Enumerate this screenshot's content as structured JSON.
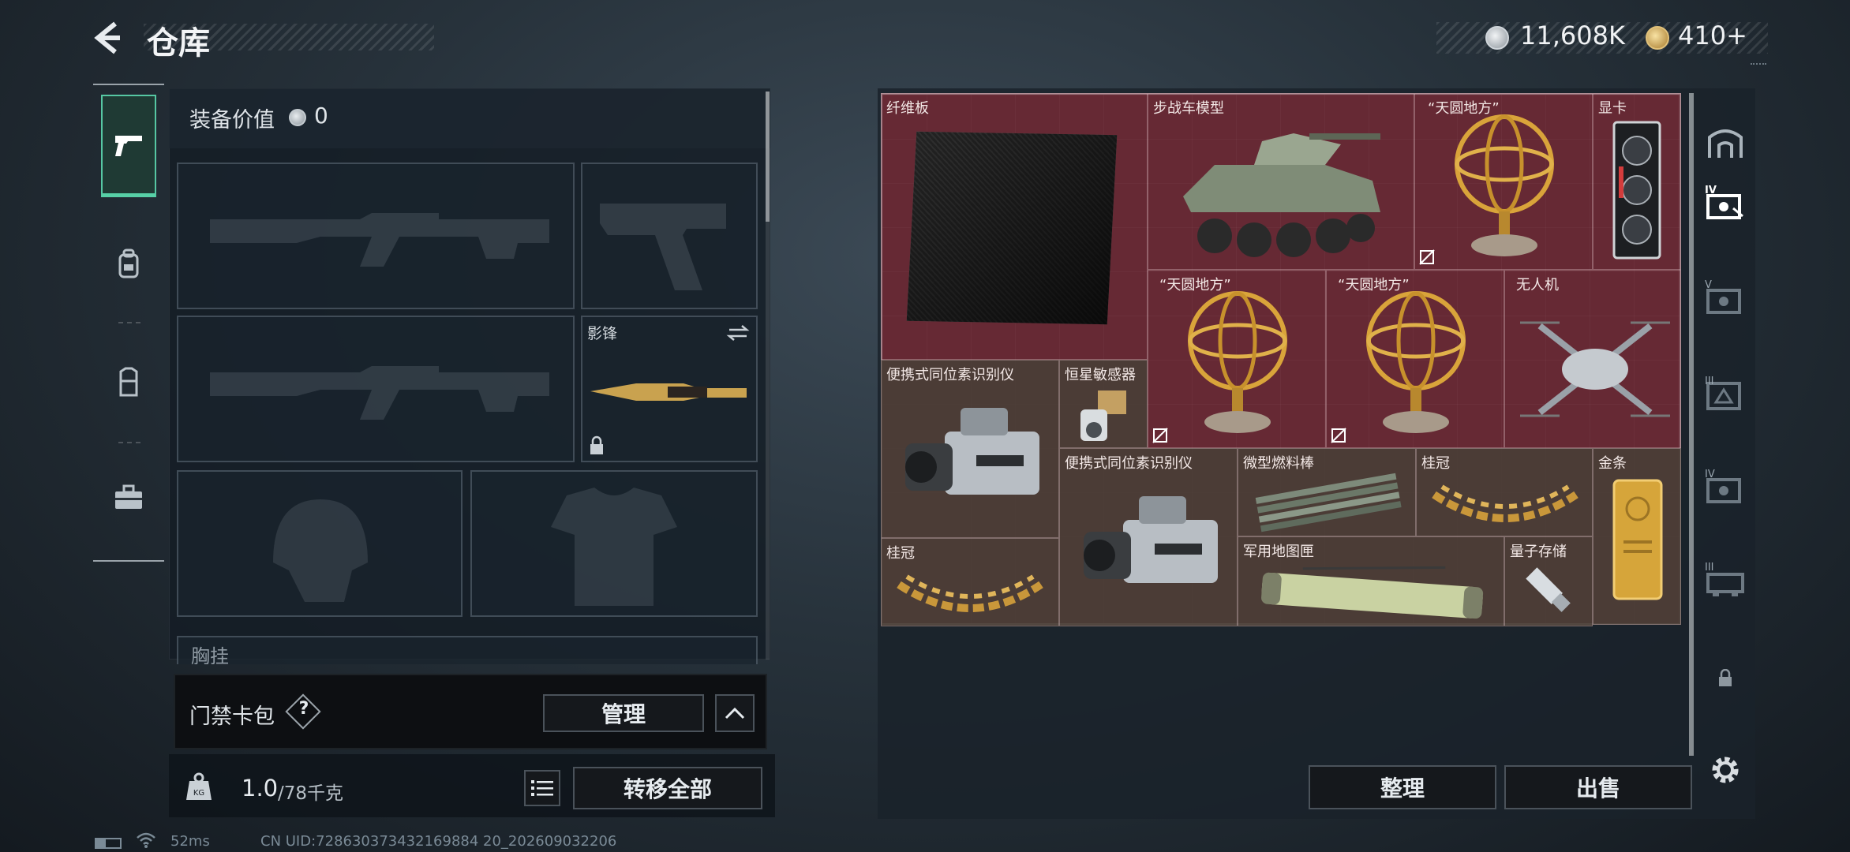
{
  "header": {
    "title": "仓库",
    "currencies": [
      {
        "icon": "silver-coin-icon",
        "value": "11,608K"
      },
      {
        "icon": "gold-coin-icon",
        "value": "410+"
      }
    ]
  },
  "tabs": [
    {
      "name": "pistol-icon",
      "active": true
    },
    {
      "name": "backpack-icon",
      "active": false
    },
    {
      "name": "vest-icon",
      "active": false
    },
    {
      "name": "briefcase-icon",
      "active": false
    }
  ],
  "equipment": {
    "value_label": "装备价值",
    "value": "0",
    "melee_name": "影锋",
    "chest_label": "胸挂"
  },
  "keycard": {
    "label": "门禁卡包",
    "help": "?",
    "manage_button": "管理"
  },
  "bottom": {
    "weight_current": "1.0",
    "weight_max": "/78千克",
    "transfer_all_button": "转移全部"
  },
  "inventory": {
    "items": [
      {
        "name": "纤维板"
      },
      {
        "name": "步战车模型"
      },
      {
        "name": "“天圆地方”"
      },
      {
        "name": "显卡"
      },
      {
        "name": "“天圆地方”"
      },
      {
        "name": "“天圆地方”"
      },
      {
        "name": "无人机"
      },
      {
        "name": "便携式同位素识别仪"
      },
      {
        "name": "恒星敏感器"
      },
      {
        "name": "便携式同位素识别仪"
      },
      {
        "name": "微型燃料棒"
      },
      {
        "name": "桂冠"
      },
      {
        "name": "金条"
      },
      {
        "name": "桂冠"
      },
      {
        "name": "军用地图匣"
      },
      {
        "name": "量子存储"
      }
    ],
    "sort_button": "整理",
    "sell_button": "出售"
  },
  "side_tabs": [
    "IV",
    "V",
    "III",
    "IV",
    "III"
  ],
  "status_bar": {
    "ping": "52ms",
    "uid": "CN UID:728630373432169884 20_202609032206"
  }
}
